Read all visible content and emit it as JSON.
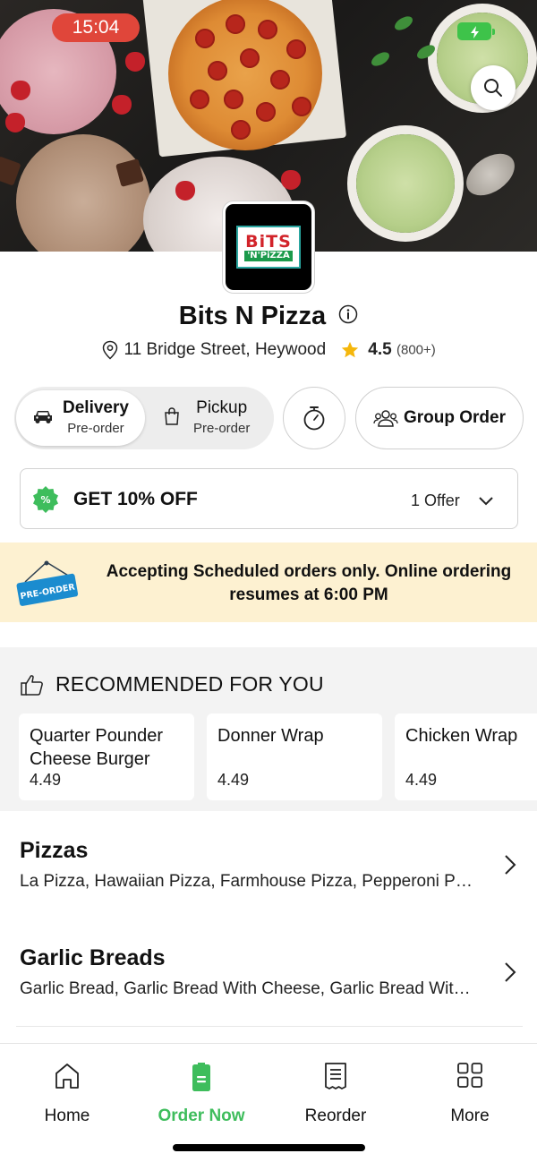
{
  "status_bar": {
    "time": "15:04"
  },
  "store": {
    "name": "Bits N Pizza",
    "logo_text_top": "BiTS",
    "logo_text_bottom": "'N'PiZZA",
    "address": "11 Bridge Street, Heywood",
    "rating": "4.5",
    "rating_count": "(800+)"
  },
  "order_modes": {
    "delivery": {
      "label": "Delivery",
      "sub": "Pre-order"
    },
    "pickup": {
      "label": "Pickup",
      "sub": "Pre-order"
    },
    "group_order_label": "Group Order"
  },
  "offer": {
    "title": "GET 10% OFF",
    "count": "1 Offer"
  },
  "banner": {
    "sign_text": "PRE-ORDER",
    "message": "Accepting Scheduled orders only. Online ordering resumes at 6:00 PM"
  },
  "recommended": {
    "heading": "RECOMMENDED FOR YOU",
    "items": [
      {
        "name": "Quarter Pounder Cheese Burger",
        "price": "4.49"
      },
      {
        "name": "Donner Wrap",
        "price": "4.49"
      },
      {
        "name": "Chicken Wrap",
        "price": "4.49"
      }
    ]
  },
  "categories": [
    {
      "title": "Pizzas",
      "items": "La Pizza, Hawaiian Pizza, Farmhouse Pizza, Pepperoni Pizza"
    },
    {
      "title": "Garlic Breads",
      "items": "Garlic Bread, Garlic Bread With Cheese, Garlic Bread With Cheese & Tomato"
    }
  ],
  "tabbar": {
    "tabs": [
      {
        "label": "Home",
        "icon": "home-icon"
      },
      {
        "label": "Order Now",
        "icon": "order-icon",
        "active": true
      },
      {
        "label": "Reorder",
        "icon": "receipt-icon"
      },
      {
        "label": "More",
        "icon": "grid-icon"
      }
    ]
  },
  "colors": {
    "accent_green": "#3ebd5c",
    "time_pill": "#e0463a",
    "banner_bg": "#fdf1d1",
    "star": "#f5b70c"
  }
}
